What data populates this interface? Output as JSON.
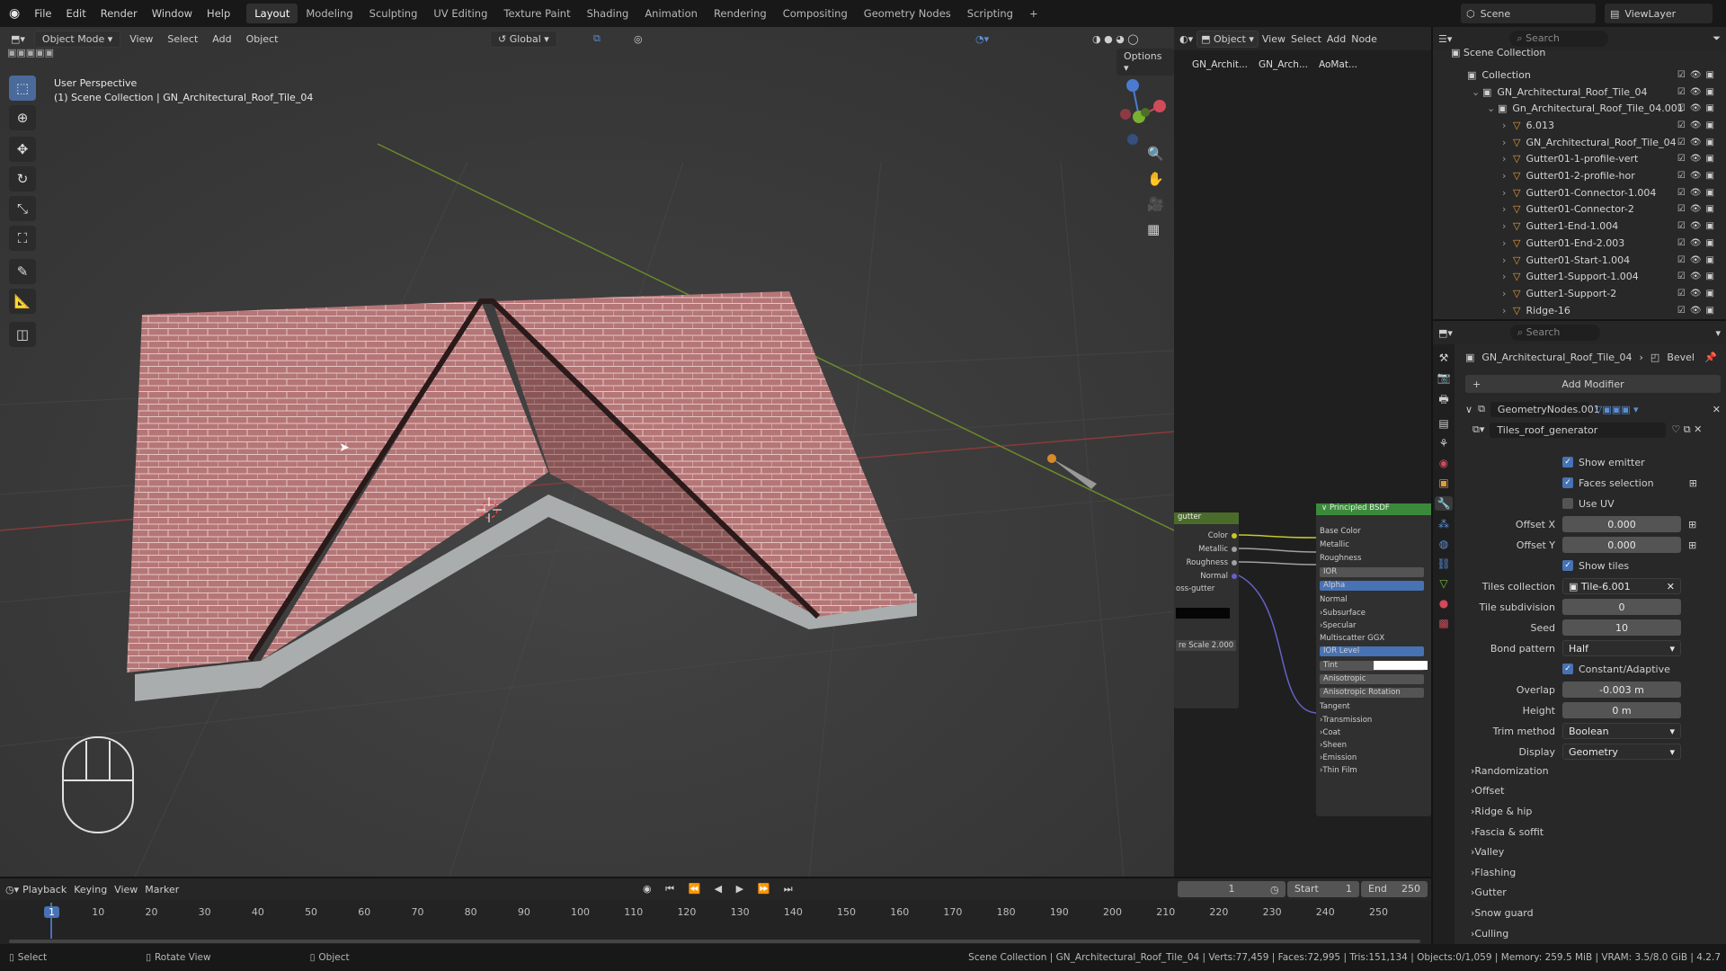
{
  "topbar": {
    "menus": [
      "File",
      "Edit",
      "Render",
      "Window",
      "Help"
    ],
    "workspaces": [
      "Layout",
      "Modeling",
      "Sculpting",
      "UV Editing",
      "Texture Paint",
      "Shading",
      "Animation",
      "Rendering",
      "Compositing",
      "Geometry Nodes",
      "Scripting",
      "+"
    ],
    "active_workspace": "Layout",
    "scene": "Scene",
    "view_layer": "ViewLayer"
  },
  "viewport": {
    "mode": "Object Mode",
    "menus": [
      "View",
      "Select",
      "Add",
      "Object"
    ],
    "orientation": "Global",
    "options": "Options",
    "perspective": "User Perspective",
    "collection_info": "(1) Scene Collection | GN_Architectural_Roof_Tile_04"
  },
  "node_editor": {
    "type": "Object",
    "menus": [
      "View",
      "Select",
      "Add",
      "Node"
    ],
    "breadcrumbs": [
      "GN_Archit...",
      "GN_Arch...",
      "AoMat..."
    ],
    "left_node_title": "gutter",
    "left_sockets": [
      "Color",
      "Metallic",
      "Roughness",
      "Normal"
    ],
    "left_extra": "oss-gutter",
    "left_scale": "re Scale  2.000",
    "bsdf_title": "Principled BSDF",
    "bsdf_sockets": [
      "Base Color",
      "Metallic",
      "Roughness",
      "IOR",
      "Alpha",
      "Normal",
      "Subsurface",
      "Specular",
      "Multiscatter GGX",
      "IOR Level",
      "Tint",
      "Anisotropic",
      "Anisotropic Rotation",
      "Tangent",
      "Transmission",
      "Coat",
      "Sheen",
      "Emission",
      "Thin Film"
    ]
  },
  "outliner": {
    "search_placeholder": "Search",
    "root": "Scene Collection",
    "items": [
      {
        "name": "Collection",
        "indent": 0
      },
      {
        "name": "GN_Architectural_Roof_Tile_04",
        "indent": 1
      },
      {
        "name": "Gn_Architectural_Roof_Tile_04.001",
        "indent": 2
      },
      {
        "name": "6.013",
        "indent": 3
      },
      {
        "name": "GN_Architectural_Roof_Tile_04",
        "indent": 3
      },
      {
        "name": "Gutter01-1-profile-vert",
        "indent": 3
      },
      {
        "name": "Gutter01-2-profile-hor",
        "indent": 3
      },
      {
        "name": "Gutter01-Connector-1.004",
        "indent": 3
      },
      {
        "name": "Gutter01-Connector-2",
        "indent": 3
      },
      {
        "name": "Gutter1-End-1.004",
        "indent": 3
      },
      {
        "name": "Gutter01-End-2.003",
        "indent": 3
      },
      {
        "name": "Gutter01-Start-1.004",
        "indent": 3
      },
      {
        "name": "Gutter1-Support-1.004",
        "indent": 3
      },
      {
        "name": "Gutter1-Support-2",
        "indent": 3
      },
      {
        "name": "Ridge-16",
        "indent": 3
      }
    ]
  },
  "properties": {
    "search_placeholder": "Search",
    "object": "GN_Architectural_Roof_Tile_04",
    "modifier_context": "Bevel",
    "add_modifier": "Add Modifier",
    "modifier_name": "GeometryNodes.001",
    "node_group": "Tiles_roof_generator",
    "checks": [
      {
        "label": "Show emitter",
        "checked": true
      },
      {
        "label": "Faces selection",
        "checked": true
      },
      {
        "label": "Use UV",
        "checked": false
      }
    ],
    "offset_x_label": "Offset X",
    "offset_x": "0.000",
    "offset_y_label": "Offset Y",
    "offset_y": "0.000",
    "show_tiles": "Show tiles",
    "tiles_collection_label": "Tiles collection",
    "tiles_collection": "Tile-6.001",
    "tile_subdivision_label": "Tile subdivision",
    "tile_subdivision": "0",
    "seed_label": "Seed",
    "seed": "10",
    "bond_pattern_label": "Bond pattern",
    "bond_pattern": "Half",
    "constant_adaptive": "Constant/Adaptive",
    "overlap_label": "Overlap",
    "overlap": "-0.003 m",
    "height_label": "Height",
    "height": "0 m",
    "trim_method_label": "Trim method",
    "trim_method": "Boolean",
    "display_label": "Display",
    "display": "Geometry",
    "panels": [
      "Randomization",
      "Offset",
      "Ridge & hip",
      "Fascia & soffit",
      "Valley",
      "Flashing",
      "Gutter",
      "Snow guard",
      "Culling"
    ]
  },
  "timeline": {
    "menus": [
      "Playback",
      "Keying",
      "View",
      "Marker"
    ],
    "current_frame": "1",
    "start_label": "Start",
    "start": "1",
    "end_label": "End",
    "end": "250",
    "ticks": [
      "1",
      "10",
      "20",
      "30",
      "40",
      "50",
      "60",
      "70",
      "80",
      "90",
      "100",
      "110",
      "120",
      "130",
      "140",
      "150",
      "160",
      "170",
      "180",
      "190",
      "200",
      "210",
      "220",
      "230",
      "240",
      "250"
    ]
  },
  "statusbar": {
    "select": "Select",
    "rotate": "Rotate View",
    "object": "Object",
    "stats": "Scene Collection | GN_Architectural_Roof_Tile_04 | Verts:77,459 | Faces:72,995 | Tris:151,134 | Objects:0/1,059 | Memory: 259.5 MiB | VRAM: 3.5/8.0 GiB | 4.2.7"
  }
}
